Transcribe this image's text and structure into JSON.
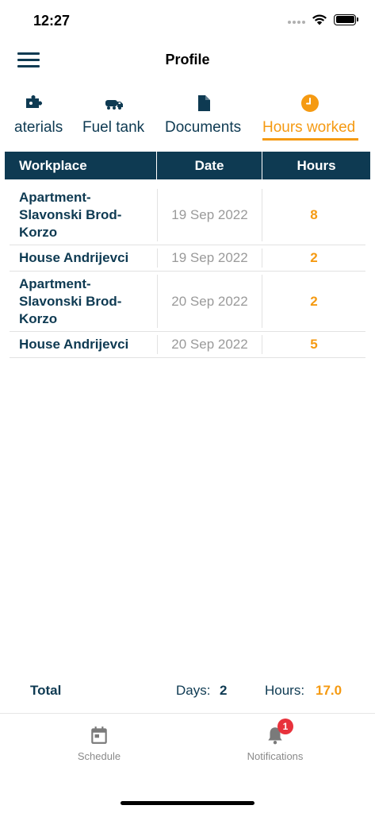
{
  "status": {
    "time": "12:27"
  },
  "header": {
    "title": "Profile"
  },
  "tabs": [
    {
      "label": "aterials",
      "icon": "puzzle-icon",
      "active": false
    },
    {
      "label": "Fuel tank",
      "icon": "truck-icon",
      "active": false
    },
    {
      "label": "Documents",
      "icon": "document-icon",
      "active": false
    },
    {
      "label": "Hours worked",
      "icon": "clock-icon",
      "active": true
    }
  ],
  "table": {
    "columns": [
      "Workplace",
      "Date",
      "Hours"
    ],
    "rows": [
      {
        "workplace": "Apartment-Slavonski Brod-Korzo",
        "date": "19 Sep 2022",
        "hours": "8"
      },
      {
        "workplace": "House Andrijevci",
        "date": "19 Sep 2022",
        "hours": "2"
      },
      {
        "workplace": "Apartment-Slavonski Brod-Korzo",
        "date": "20 Sep 2022",
        "hours": "2"
      },
      {
        "workplace": "House Andrijevci",
        "date": "20 Sep 2022",
        "hours": "5"
      }
    ]
  },
  "summary": {
    "total_label": "Total",
    "days_label": "Days:",
    "days_value": "2",
    "hours_label": "Hours:",
    "hours_value": "17.0"
  },
  "tabbar": {
    "items": [
      {
        "label": "Schedule",
        "icon": "calendar-icon"
      },
      {
        "label": "Notifications",
        "icon": "bell-icon",
        "badge": "1"
      }
    ]
  },
  "colors": {
    "primary": "#0e3a52",
    "accent": "#f59a12",
    "badge": "#e8323c",
    "muted": "#9a9a9a"
  }
}
